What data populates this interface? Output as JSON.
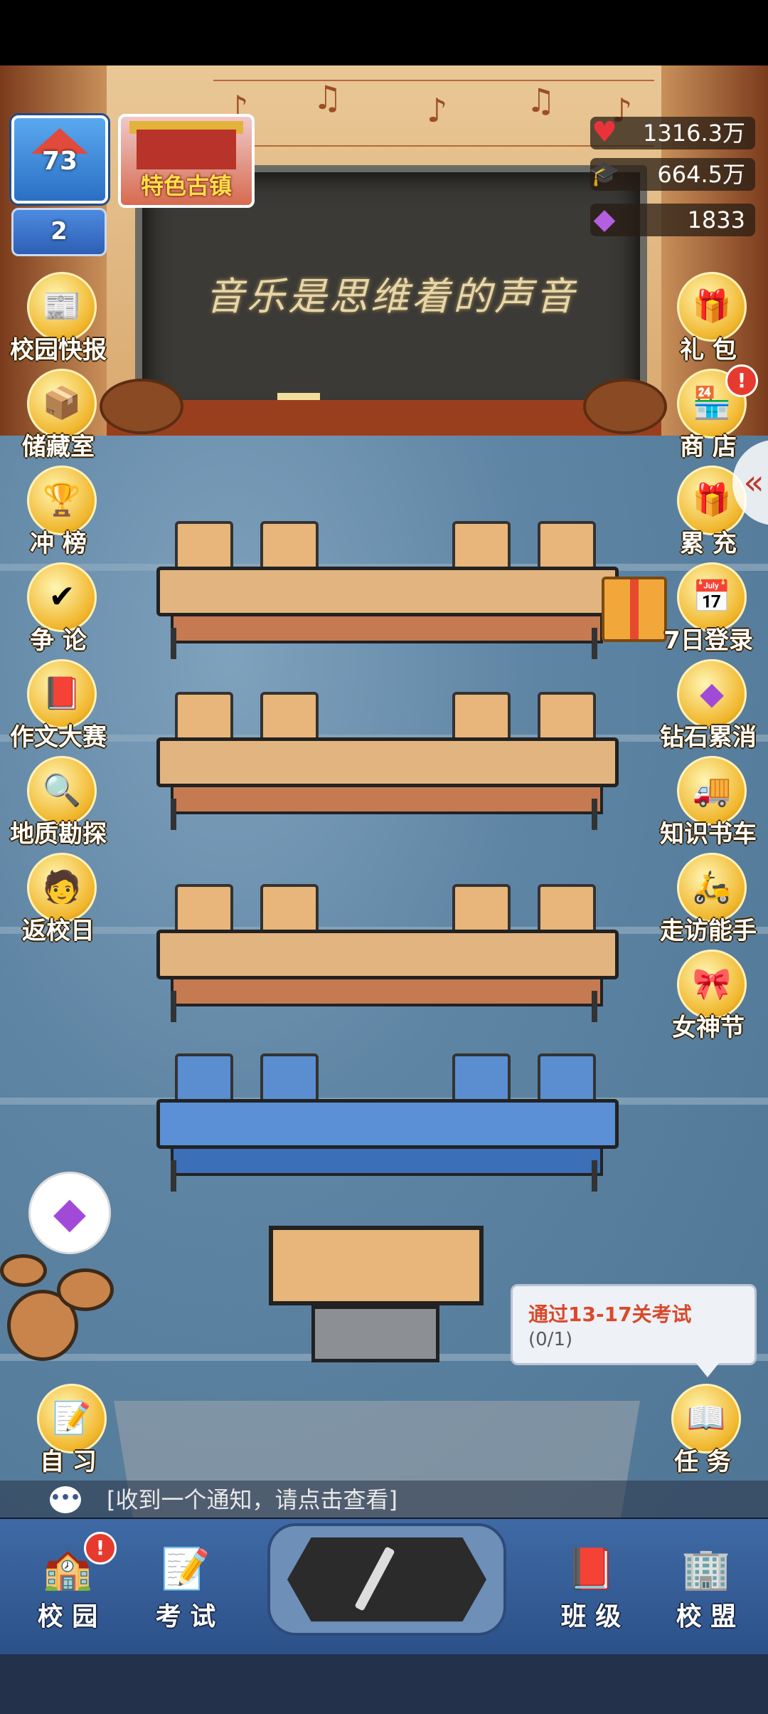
{
  "school_badge": {
    "level": "73"
  },
  "rank_badge": {
    "level": "2"
  },
  "town_badge": {
    "label": "特色古镇"
  },
  "resources": [
    {
      "icon": "heart-icon",
      "value": "1316.3万"
    },
    {
      "icon": "graduation-cap-icon",
      "value": "664.5万"
    },
    {
      "icon": "diamond-icon",
      "value": "1833"
    }
  ],
  "blackboard": {
    "title": "音乐是思维着的声音"
  },
  "left_menu": [
    {
      "label": "校园快报",
      "icon": "newspaper-icon"
    },
    {
      "label": "储藏室",
      "icon": "boxes-icon"
    },
    {
      "label": "冲 榜",
      "icon": "trophy-icon"
    },
    {
      "label": "争 论",
      "icon": "debate-icon"
    },
    {
      "label": "作文大赛",
      "icon": "essay-book-icon"
    },
    {
      "label": "地质勘探",
      "icon": "magnifier-icon"
    },
    {
      "label": "返校日",
      "icon": "student-icon"
    }
  ],
  "right_menu": [
    {
      "label": "礼 包",
      "icon": "gift-pack-icon"
    },
    {
      "label": "商 店",
      "icon": "shop-icon",
      "badge": "!"
    },
    {
      "label": "累 充",
      "icon": "gift-box-icon"
    },
    {
      "label": "7日登录",
      "icon": "calendar-icon"
    },
    {
      "label": "钻石累消",
      "icon": "diamond-pile-icon"
    },
    {
      "label": "知识书车",
      "icon": "book-truck-icon"
    },
    {
      "label": "走访能手",
      "icon": "scooter-icon"
    },
    {
      "label": "女神节",
      "icon": "bow-icon"
    }
  ],
  "self_study": {
    "label": "自 习"
  },
  "task": {
    "label": "任 务",
    "tip_title": "通过13-17关考试",
    "tip_progress": "(0/1)"
  },
  "notice": {
    "text": "[收到一个通知，请点击查看]"
  },
  "bottom_nav": [
    {
      "label": "校 园",
      "icon": "campus-icon",
      "badge": "!"
    },
    {
      "label": "考 试",
      "icon": "exam-paper-icon"
    },
    {
      "label": "班 级",
      "icon": "class-book-icon"
    },
    {
      "label": "校 盟",
      "icon": "alliance-building-icon"
    }
  ]
}
